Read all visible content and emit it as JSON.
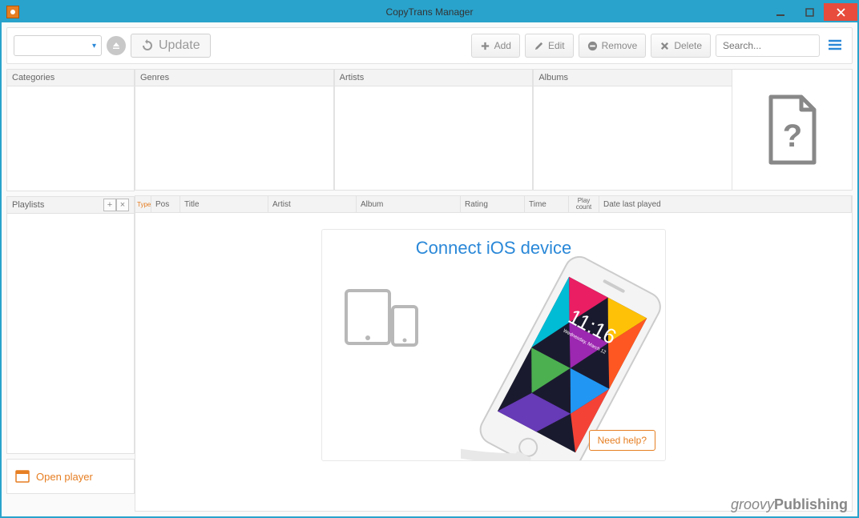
{
  "window": {
    "title": "CopyTrans Manager"
  },
  "toolbar": {
    "update": "Update",
    "add": "Add",
    "edit": "Edit",
    "remove": "Remove",
    "delete": "Delete",
    "search_placeholder": "Search..."
  },
  "panels": {
    "categories": "Categories",
    "genres": "Genres",
    "artists": "Artists",
    "albums": "Albums",
    "playlists": "Playlists"
  },
  "columns": {
    "type": "Type",
    "pos": "Pos",
    "title": "Title",
    "artist": "Artist",
    "album": "Album",
    "rating": "Rating",
    "time": "Time",
    "playcount": "Play count",
    "date": "Date last played"
  },
  "connect": {
    "title": "Connect iOS device",
    "help": "Need help?"
  },
  "open_player": "Open player",
  "brand": {
    "a": "groovy",
    "b": "Publishing"
  },
  "iphone": {
    "time": "11:16",
    "date": "Wednesday, March 12"
  }
}
